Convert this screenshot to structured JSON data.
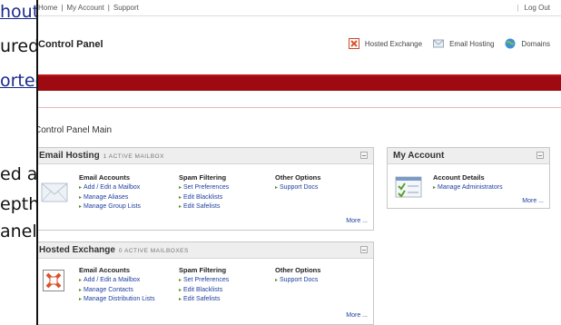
{
  "bleed": [
    "hout",
    "ured",
    "orted",
    "ed a",
    "epth",
    "anel,"
  ],
  "topbar": {
    "links": [
      "Home",
      "My Account",
      "Support"
    ],
    "logout": "Log Out"
  },
  "header": {
    "title": "Control Panel",
    "services": [
      {
        "label": "Hosted Exchange",
        "icon": "exchange-icon"
      },
      {
        "label": "Email Hosting",
        "icon": "envelope-icon"
      },
      {
        "label": "Domains",
        "icon": "globe-icon"
      }
    ]
  },
  "main": {
    "title": "Control Panel Main",
    "email_hosting": {
      "title": "Email Hosting",
      "subtitle": "1 ACTIVE MAILBOX",
      "columns": [
        {
          "heading": "Email Accounts",
          "links": [
            "Add / Edit a Mailbox",
            "Manage Aliases",
            "Manage Group Lists"
          ]
        },
        {
          "heading": "Spam Filtering",
          "links": [
            "Set Preferences",
            "Edit Blacklists",
            "Edit Safelists"
          ]
        },
        {
          "heading": "Other Options",
          "links": [
            "Support Docs"
          ]
        }
      ],
      "more": "More ..."
    },
    "my_account": {
      "title": "My Account",
      "columns": [
        {
          "heading": "Account Details",
          "links": [
            "Manage Administrators"
          ]
        }
      ],
      "more": "More ..."
    },
    "hosted_exchange": {
      "title": "Hosted Exchange",
      "subtitle": "0 ACTIVE MAILBOXES",
      "columns": [
        {
          "heading": "Email Accounts",
          "links": [
            "Add / Edit a Mailbox",
            "Manage Contacts",
            "Manage Distribution Lists"
          ]
        },
        {
          "heading": "Spam Filtering",
          "links": [
            "Set Preferences",
            "Edit Blacklists",
            "Edit Safelists"
          ]
        },
        {
          "heading": "Other Options",
          "links": [
            "Support Docs"
          ]
        }
      ],
      "more": "More ..."
    }
  },
  "colors": {
    "brand_red": "#9e0a12",
    "link_blue": "#1f3fa0",
    "arrow_green": "#5a8a20"
  }
}
